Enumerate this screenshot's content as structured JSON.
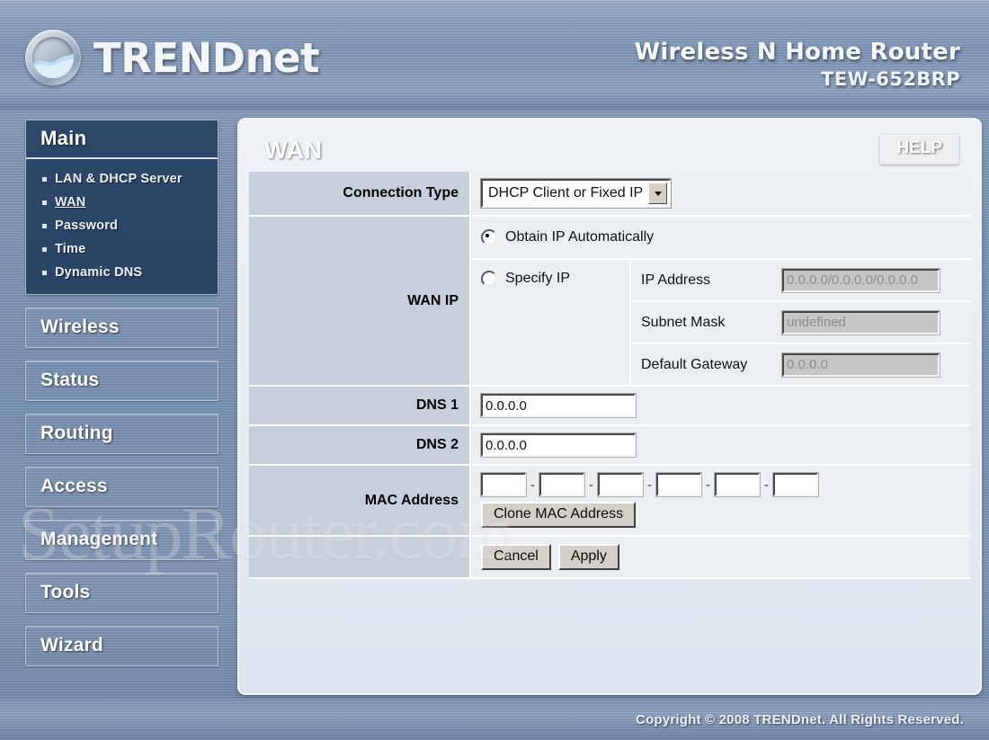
{
  "header": {
    "brand": "TRENDnet",
    "product_name": "Wireless N Home Router",
    "model": "TEW-652BRP"
  },
  "watermark": "SetupRouter.com",
  "sidebar": {
    "main_group": {
      "title": "Main",
      "items": [
        {
          "label": "LAN & DHCP Server",
          "active": false
        },
        {
          "label": "WAN",
          "active": true
        },
        {
          "label": "Password",
          "active": false
        },
        {
          "label": "Time",
          "active": false
        },
        {
          "label": "Dynamic DNS",
          "active": false
        }
      ]
    },
    "buttons": [
      {
        "label": "Wireless"
      },
      {
        "label": "Status"
      },
      {
        "label": "Routing"
      },
      {
        "label": "Access"
      },
      {
        "label": "Management"
      },
      {
        "label": "Tools"
      },
      {
        "label": "Wizard"
      }
    ]
  },
  "panel": {
    "title": "WAN",
    "help_label": "HELP",
    "rows": {
      "connection_type": {
        "label": "Connection Type",
        "selected": "DHCP Client or Fixed IP"
      },
      "wan_ip": {
        "label": "WAN IP",
        "option_auto": "Obtain IP Automatically",
        "option_specify": "Specify IP",
        "auto_selected": true,
        "fields": [
          {
            "name": "IP Address",
            "value": "0.0.0.0/0.0.0.0/0.0.0.0",
            "disabled": true
          },
          {
            "name": "Subnet Mask",
            "value": "undefined",
            "disabled": true
          },
          {
            "name": "Default Gateway",
            "value": "0.0.0.0",
            "disabled": true
          }
        ]
      },
      "dns1": {
        "label": "DNS 1",
        "value": "0.0.0.0"
      },
      "dns2": {
        "label": "DNS 2",
        "value": "0.0.0.0"
      },
      "mac_address": {
        "label": "MAC Address",
        "octets": [
          "",
          "",
          "",
          "",
          "",
          ""
        ],
        "separator": "-",
        "clone_label": "Clone MAC Address"
      },
      "actions": {
        "cancel_label": "Cancel",
        "apply_label": "Apply"
      }
    }
  },
  "footer": {
    "copyright": "Copyright © 2008 TRENDnet. All Rights Reserved."
  }
}
